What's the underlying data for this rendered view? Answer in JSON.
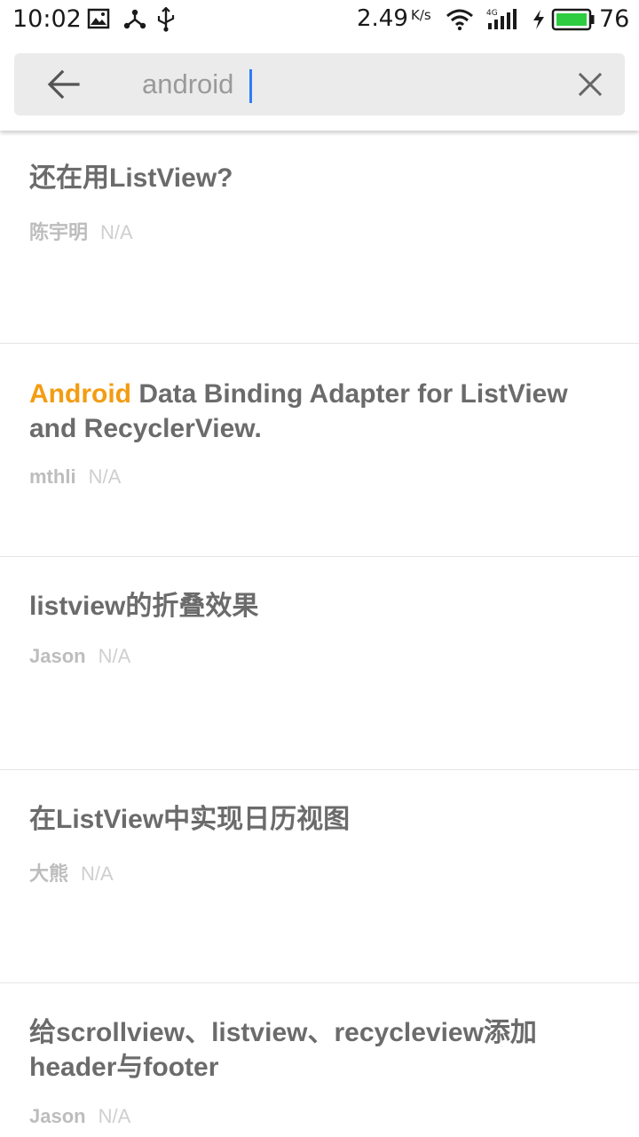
{
  "status_bar": {
    "time": "10:02",
    "net_speed": "2.49",
    "net_unit": "K/s",
    "battery_level": "76",
    "battery_color": "#2ecc40",
    "icons": [
      "image-icon",
      "share-icon",
      "usb-icon",
      "wifi-icon",
      "signal-4g-icon",
      "charging-icon",
      "battery-icon"
    ]
  },
  "search": {
    "value": "android",
    "accent": "#2f7cf6"
  },
  "results": [
    {
      "title": "还在用ListView?",
      "author": "陈宇明",
      "date": "N/A"
    },
    {
      "title_highlight": "Android",
      "title_rest": " Data Binding Adapter for ListView and RecyclerView.",
      "author": "mthli",
      "date": "N/A"
    },
    {
      "title": "listview的折叠效果",
      "author": "Jason",
      "date": "N/A"
    },
    {
      "title": "在ListView中实现日历视图",
      "author": "大熊",
      "date": "N/A"
    },
    {
      "title": "给scrollview、listview、recycleview添加header与footer",
      "author": "Jason",
      "date": "N/A"
    }
  ],
  "highlight_color": "#f39c12"
}
